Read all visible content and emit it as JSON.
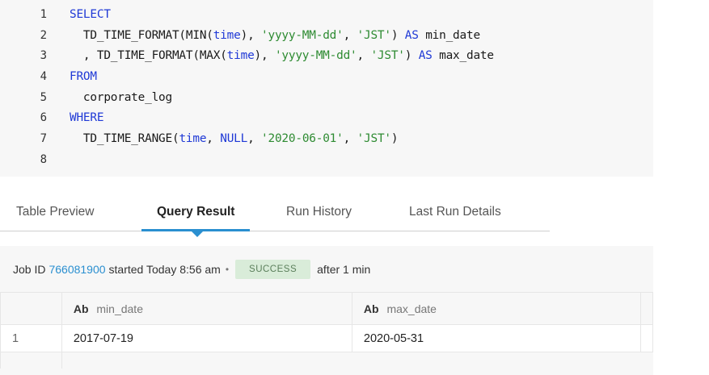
{
  "editor": {
    "line_numbers": [
      "1",
      "2",
      "3",
      "4",
      "5",
      "6",
      "7",
      "8"
    ],
    "lines": [
      [
        {
          "t": "SELECT",
          "c": "kw"
        }
      ],
      [
        {
          "t": "  TD_TIME_FORMAT(MIN(",
          "c": ""
        },
        {
          "t": "time",
          "c": "kw"
        },
        {
          "t": "), ",
          "c": ""
        },
        {
          "t": "'yyyy-MM-dd'",
          "c": "str"
        },
        {
          "t": ", ",
          "c": ""
        },
        {
          "t": "'JST'",
          "c": "str"
        },
        {
          "t": ") ",
          "c": ""
        },
        {
          "t": "AS",
          "c": "kw"
        },
        {
          "t": " min_date",
          "c": ""
        }
      ],
      [
        {
          "t": "  , TD_TIME_FORMAT(MAX(",
          "c": ""
        },
        {
          "t": "time",
          "c": "kw"
        },
        {
          "t": "), ",
          "c": ""
        },
        {
          "t": "'yyyy-MM-dd'",
          "c": "str"
        },
        {
          "t": ", ",
          "c": ""
        },
        {
          "t": "'JST'",
          "c": "str"
        },
        {
          "t": ") ",
          "c": ""
        },
        {
          "t": "AS",
          "c": "kw"
        },
        {
          "t": " max_date",
          "c": ""
        }
      ],
      [
        {
          "t": "FROM",
          "c": "kw"
        }
      ],
      [
        {
          "t": "  corporate_log",
          "c": ""
        }
      ],
      [
        {
          "t": "WHERE",
          "c": "kw"
        }
      ],
      [
        {
          "t": "  TD_TIME_RANGE(",
          "c": ""
        },
        {
          "t": "time",
          "c": "kw"
        },
        {
          "t": ", ",
          "c": ""
        },
        {
          "t": "NULL",
          "c": "kw"
        },
        {
          "t": ", ",
          "c": ""
        },
        {
          "t": "'2020-06-01'",
          "c": "str"
        },
        {
          "t": ", ",
          "c": ""
        },
        {
          "t": "'JST'",
          "c": "str"
        },
        {
          "t": ")",
          "c": ""
        }
      ],
      [
        {
          "t": "",
          "c": ""
        }
      ]
    ]
  },
  "tabs": {
    "table_preview": "Table Preview",
    "query_result": "Query Result",
    "run_history": "Run History",
    "last_run_details": "Last Run Details"
  },
  "job": {
    "prefix": "Job ID",
    "id": "766081900",
    "started": "started Today 8:56 am",
    "dot": "•",
    "status": "SUCCESS",
    "duration": "after 1 min"
  },
  "result_table": {
    "type_tag": "Ab",
    "columns": [
      "min_date",
      "max_date"
    ],
    "rows": [
      {
        "num": "1",
        "values": [
          "2017-07-19",
          "2020-05-31"
        ]
      }
    ]
  },
  "colors": {
    "keyword": "#1f39d6",
    "string": "#2e8b32",
    "accent": "#2a8fd0",
    "success_bg": "#d9ecd9"
  }
}
